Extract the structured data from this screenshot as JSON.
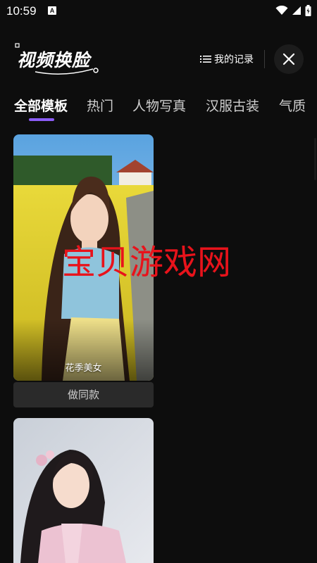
{
  "status_bar": {
    "time": "10:59",
    "notification_letter": "A"
  },
  "header": {
    "app_title": "视频换脸",
    "records_label": "我的记录"
  },
  "tabs": [
    "全部模板",
    "热门",
    "人物写真",
    "汉服古装",
    "气质"
  ],
  "active_tab": 0,
  "cards": [
    {
      "caption": "花季美女",
      "button_label": "做同款"
    }
  ],
  "watermark": "宝贝游戏网",
  "colors": {
    "background": "#0d0d0d",
    "accent": "#8b5cf6",
    "watermark": "#e8131b",
    "button_bg": "#2a2a2a"
  }
}
